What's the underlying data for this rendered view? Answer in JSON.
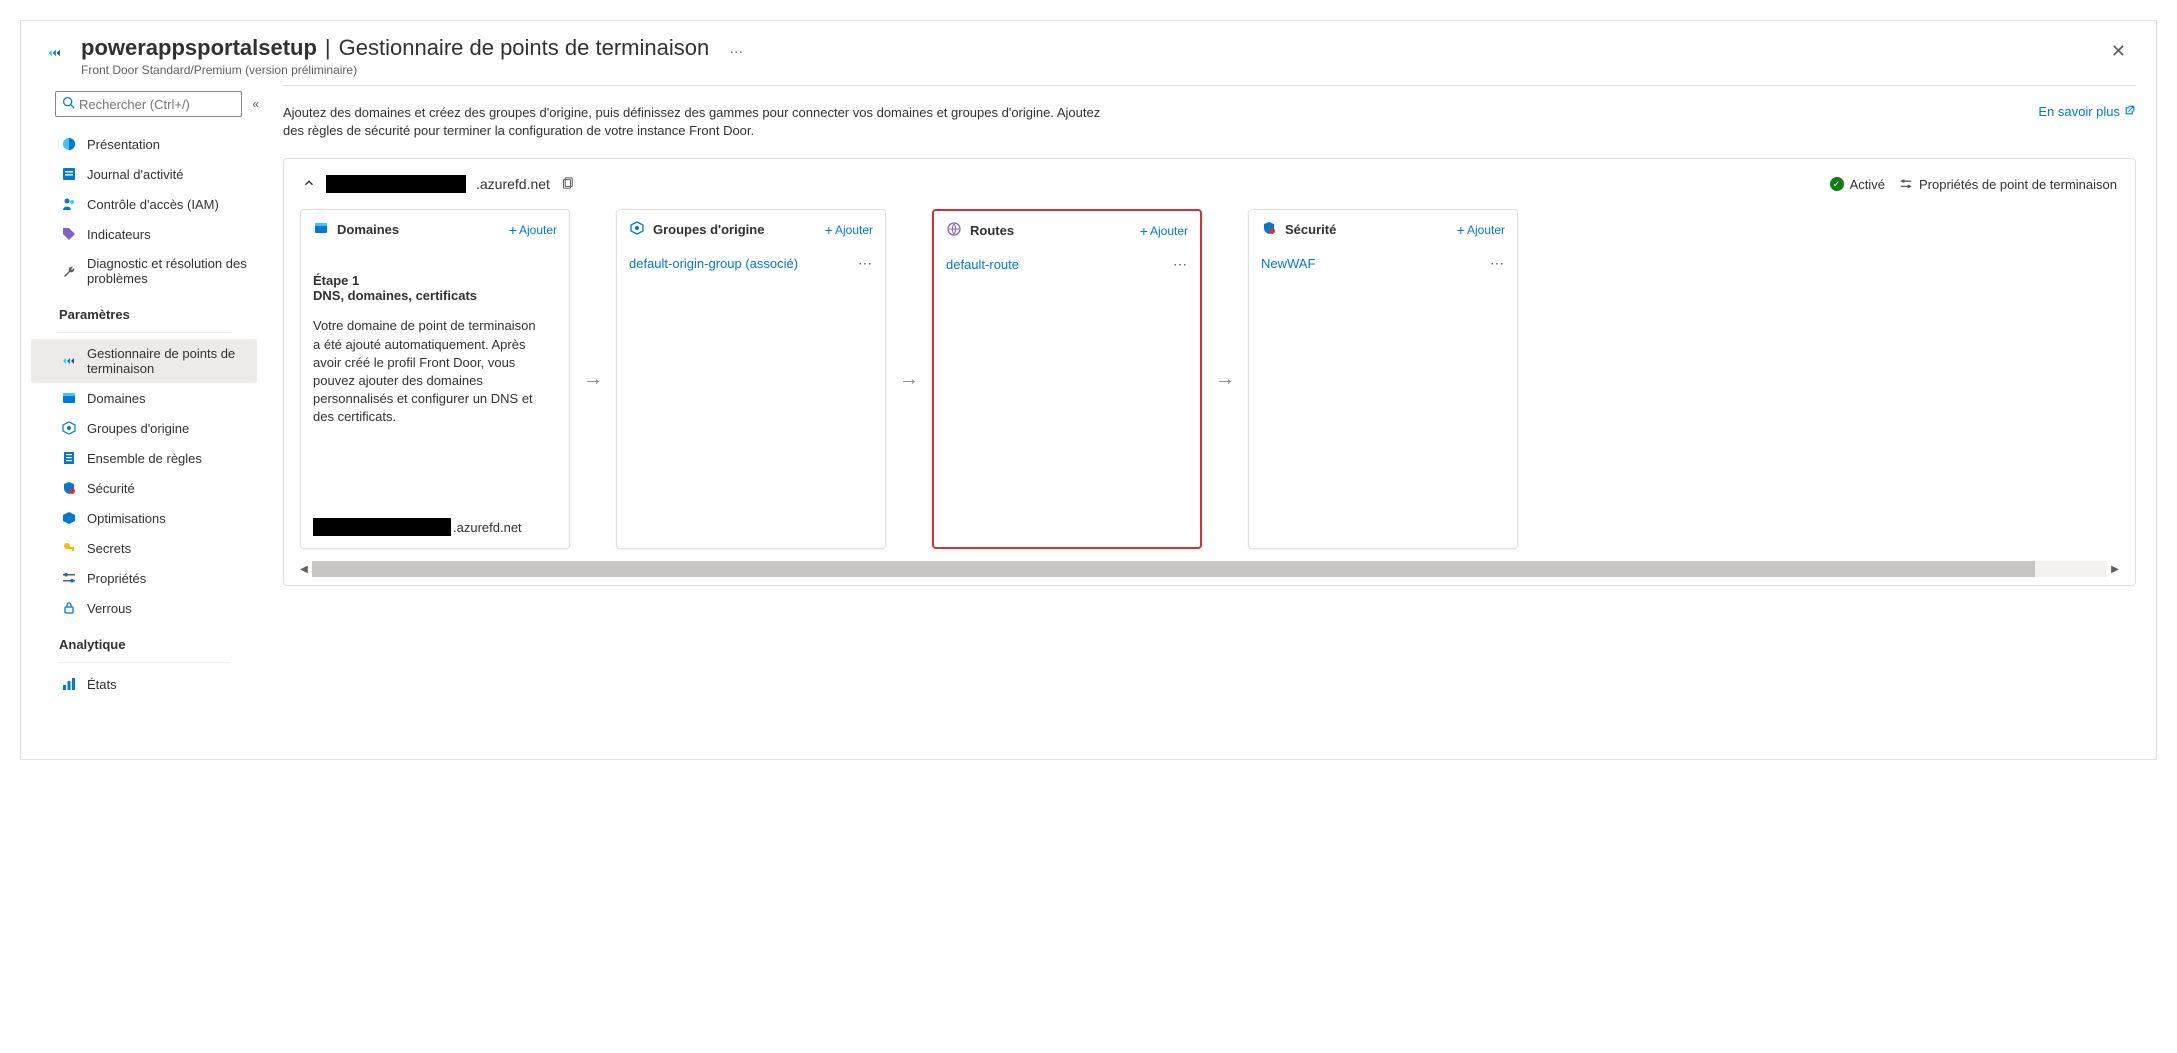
{
  "header": {
    "title": "powerappsportalsetup",
    "subtitle": "Gestionnaire de points de terminaison",
    "breadcrumb": "Front Door Standard/Premium (version préliminaire)"
  },
  "search": {
    "placeholder": "Rechercher (Ctrl+/)"
  },
  "nav": {
    "top": [
      {
        "label": "Présentation"
      },
      {
        "label": "Journal d'activité"
      },
      {
        "label": "Contrôle d'accès (IAM)"
      },
      {
        "label": "Indicateurs"
      },
      {
        "label": "Diagnostic et résolution des problèmes"
      }
    ],
    "section_settings": "Paramètres",
    "settings": [
      {
        "label": "Gestionnaire de points de terminaison",
        "active": true
      },
      {
        "label": "Domaines"
      },
      {
        "label": "Groupes d'origine"
      },
      {
        "label": "Ensemble de règles"
      },
      {
        "label": "Sécurité"
      },
      {
        "label": "Optimisations"
      },
      {
        "label": "Secrets"
      },
      {
        "label": "Propriétés"
      },
      {
        "label": "Verrous"
      }
    ],
    "section_analytics": "Analytique",
    "analytics": [
      {
        "label": "États"
      }
    ]
  },
  "intro": {
    "text": "Ajoutez des domaines et créez des groupes d'origine, puis définissez des gammes pour connecter vos domaines et groupes d'origine. Ajoutez des règles de sécurité pour terminer la configuration de votre instance Front Door.",
    "learn_more": "En savoir plus"
  },
  "endpoint": {
    "domain_suffix": ".azurefd.net",
    "status": "Activé",
    "properties": "Propriétés de point de terminaison"
  },
  "cards": {
    "add": "Ajouter",
    "domains": {
      "title": "Domaines",
      "step_title": "Étape 1",
      "step_sub": "DNS, domaines, certificats",
      "desc": "Votre domaine de point de terminaison a été ajouté automatiquement. Après avoir créé le profil Front Door, vous pouvez ajouter des domaines personnalisés et configurer un DNS et des certificats.",
      "footer_suffix": ".azurefd.net"
    },
    "origin": {
      "title": "Groupes d'origine",
      "item": "default-origin-group (associé)"
    },
    "routes": {
      "title": "Routes",
      "item": "default-route"
    },
    "security": {
      "title": "Sécurité",
      "item": "NewWAF"
    }
  }
}
